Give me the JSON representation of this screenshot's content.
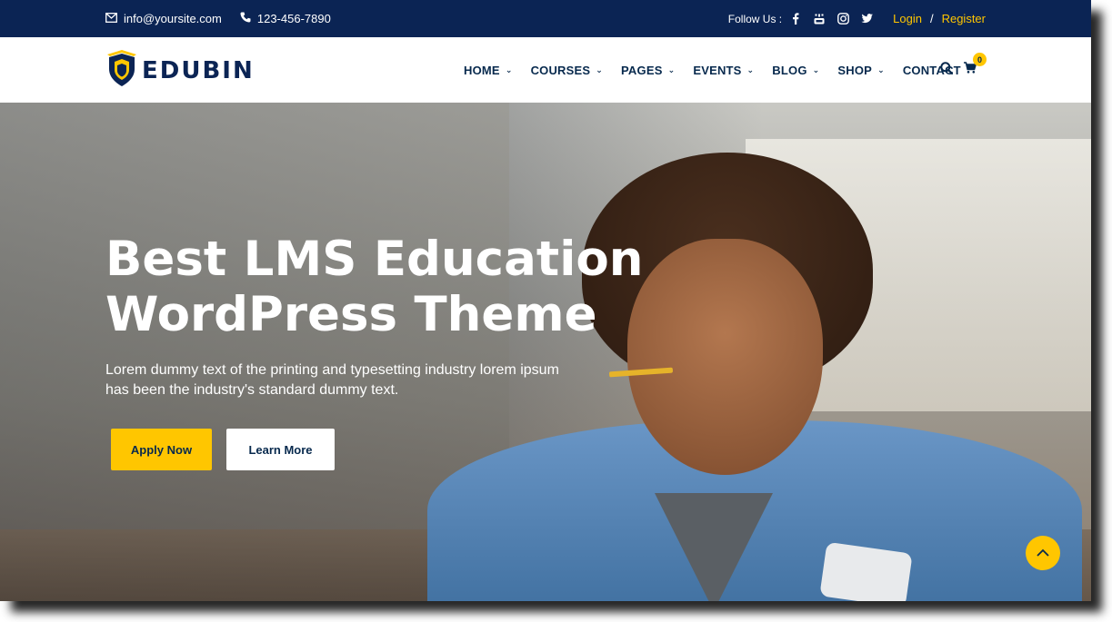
{
  "topbar": {
    "email": "info@yoursite.com",
    "phone": "123-456-7890",
    "follow_label": "Follow Us :",
    "login": "Login",
    "separator": "/",
    "register": "Register"
  },
  "brand": {
    "name": "EDUBIN"
  },
  "nav": {
    "items": [
      {
        "label": "HOME",
        "dropdown": true
      },
      {
        "label": "COURSES",
        "dropdown": true
      },
      {
        "label": "PAGES",
        "dropdown": true
      },
      {
        "label": "EVENTS",
        "dropdown": true
      },
      {
        "label": "BLOG",
        "dropdown": true
      },
      {
        "label": "SHOP",
        "dropdown": true
      },
      {
        "label": "CONTACT",
        "dropdown": false
      }
    ],
    "cart_count": "0"
  },
  "hero": {
    "title": "Best LMS Education WordPress Theme",
    "subtitle": "Lorem dummy text of the printing and typesetting industry lorem ipsum has been the industry's standard dummy text.",
    "apply_label": "Apply Now",
    "learn_label": "Learn More"
  },
  "colors": {
    "topbar_bg": "#0b2454",
    "accent": "#ffc600",
    "nav_text": "#07294d"
  },
  "icons": [
    "envelope-icon",
    "phone-icon",
    "facebook-icon",
    "youtube-icon",
    "instagram-icon",
    "twitter-icon",
    "search-icon",
    "cart-icon",
    "chevron-up-icon"
  ]
}
